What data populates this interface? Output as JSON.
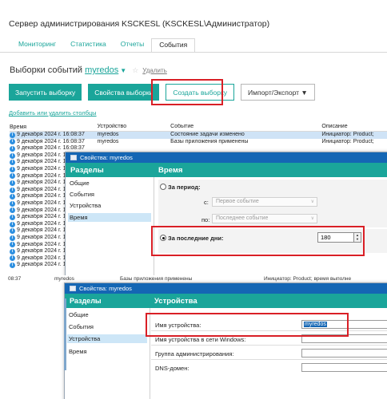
{
  "app": {
    "title": "Сервер администрирования KSCKESL (KSCKESL\\Администратор)",
    "tabs": [
      "Мониторинг",
      "Статистика",
      "Отчеты",
      "События"
    ],
    "active_tab": "События"
  },
  "view": {
    "label": "Выборки событий",
    "selection_name": "myredos",
    "caret": "▼",
    "star": "☆",
    "delete_link": "Удалить"
  },
  "toolbar": {
    "run": "Запустить выборку",
    "properties": "Свойства выборки",
    "create": "Создать выборку",
    "import_export": "Импорт/Экспорт ▼"
  },
  "add_columns_link": "Добавить или удалить столбцы",
  "table": {
    "columns": [
      "Время",
      "Устройство",
      "Событие",
      "Описание"
    ],
    "rows": [
      {
        "time": "9 декабря 2024 г. 16:08:37",
        "device": "myredos",
        "event": "Состояние задачи изменено",
        "desc": "Инициатор: Product;"
      },
      {
        "time": "9 декабря 2024 г. 16:08:37",
        "device": "myredos",
        "event": "Базы приложения применены",
        "desc": "Инициатор: Product;"
      },
      {
        "time": "9 декабря 2024 г. 16:08:37",
        "device": "",
        "event": "",
        "desc": ""
      },
      {
        "time": "9 декабря 2024 г. 16:0",
        "device": "",
        "event": "",
        "desc": ""
      },
      {
        "time": "9 декабря 2024 г. 16:0",
        "device": "",
        "event": "",
        "desc": ""
      },
      {
        "time": "9 декабря 2024 г. 16:0",
        "device": "",
        "event": "",
        "desc": ""
      },
      {
        "time": "9 декабря 2024 г. 16:0",
        "device": "",
        "event": "",
        "desc": ""
      },
      {
        "time": "9 декабря 2024 г. 16:0",
        "device": "",
        "event": "",
        "desc": ""
      },
      {
        "time": "9 декабря 2024 г. 16:0",
        "device": "",
        "event": "",
        "desc": ""
      },
      {
        "time": "9 декабря 2024 г. 16:0",
        "device": "",
        "event": "",
        "desc": ""
      },
      {
        "time": "9 декабря 2024 г. 16:0",
        "device": "",
        "event": "",
        "desc": ""
      },
      {
        "time": "9 декабря 2024 г. 16:0",
        "device": "",
        "event": "",
        "desc": ""
      },
      {
        "time": "9 декабря 2024 г. 16:0",
        "device": "",
        "event": "",
        "desc": ""
      },
      {
        "time": "9 декабря 2024 г. 16:0",
        "device": "",
        "event": "",
        "desc": ""
      },
      {
        "time": "9 декабря 2024 г. 16:0",
        "device": "",
        "event": "",
        "desc": ""
      },
      {
        "time": "9 декабря 2024 г. 16:0",
        "device": "",
        "event": "",
        "desc": ""
      },
      {
        "time": "9 декабря 2024 г. 16:0",
        "device": "",
        "event": "",
        "desc": ""
      },
      {
        "time": "9 декабря 2024 г. 16:0",
        "device": "",
        "event": "",
        "desc": ""
      },
      {
        "time": "9 декабря 2024 г. 16:0",
        "device": "",
        "event": "",
        "desc": ""
      },
      {
        "time": "9 декабря 2024 г. 16:0",
        "device": "",
        "event": "",
        "desc": ""
      }
    ]
  },
  "dialog_time": {
    "title": "Свойства: myredos",
    "sections_header": "Разделы",
    "sections": [
      "Общие",
      "События",
      "Устройства",
      "Время"
    ],
    "selected_section": "Время",
    "pane_header": "Время",
    "period_label": "За период:",
    "from_label": "с:",
    "from_value": "Первое событие",
    "to_label": "по:",
    "to_value": "Последнее событие",
    "last_days_label": "За последние дни:",
    "last_days_value": "180"
  },
  "second_shot": {
    "cut_time": "08:37",
    "cut_device": "myredos",
    "cut_event": "Базы приложения применены",
    "cut_desc": "Инициатор: Product; время выполне"
  },
  "dialog_devices": {
    "title": "Свойства: myredos",
    "sections_header": "Разделы",
    "sections": [
      "Общие",
      "События",
      "Устройства",
      "Время"
    ],
    "selected_section": "Устройства",
    "pane_header": "Устройства",
    "fields": [
      {
        "label": "Имя устройства:",
        "value": "myredos"
      },
      {
        "label": "Имя устройства в сети Windows:",
        "value": ""
      },
      {
        "label": "Группа администрирования:",
        "value": ""
      },
      {
        "label": "DNS-домен:",
        "value": ""
      }
    ]
  },
  "colors": {
    "accent": "#1aa59a",
    "titlebar": "#1466b4",
    "highlight": "#d91f26",
    "row_highlight": "#cfe3f6"
  },
  "icons": {
    "row": "info-icon",
    "window": "window-icon",
    "favorite": "star-icon",
    "dropdown": "chevron-down-icon"
  }
}
